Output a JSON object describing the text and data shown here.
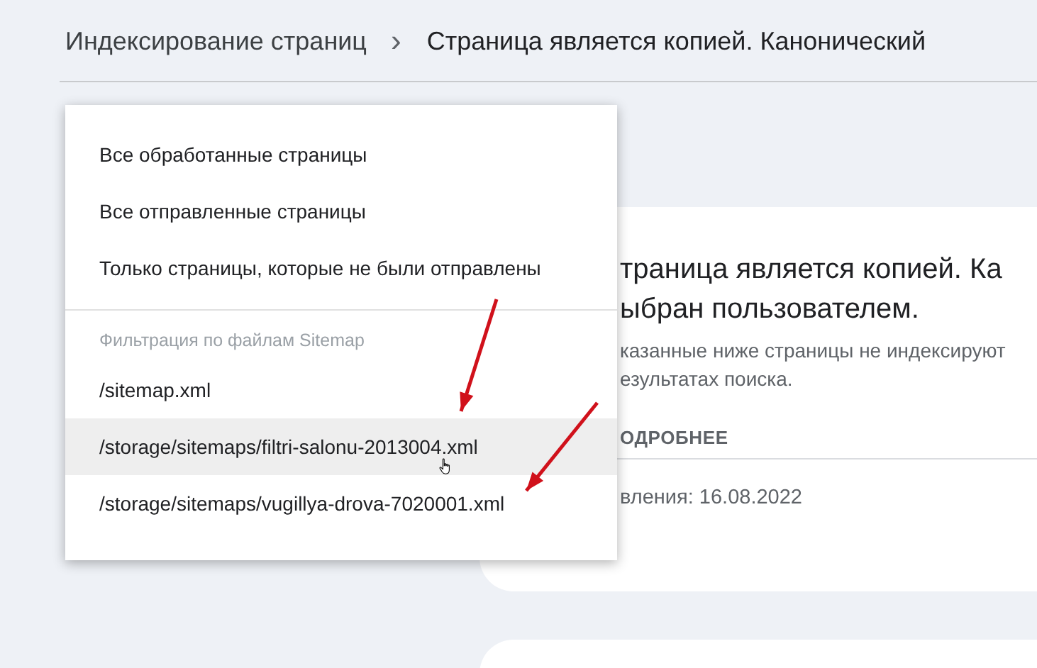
{
  "breadcrumb": {
    "parent": "Индексирование страниц",
    "separator": "›",
    "current": "Страница является копией. Канонический"
  },
  "menu": {
    "items": [
      {
        "label": "Все обработанные страницы",
        "hovered": false
      },
      {
        "label": "Все отправленные страницы",
        "hovered": false
      },
      {
        "label": "Только страницы, которые не были отправлены",
        "hovered": false
      }
    ],
    "section_header": "Фильтрация по файлам Sitemap",
    "sitemaps": [
      {
        "label": "/sitemap.xml",
        "hovered": false
      },
      {
        "label": "/storage/sitemaps/filtri-salonu-2013004.xml",
        "hovered": true
      },
      {
        "label": "/storage/sitemaps/vugillya-drova-7020001.xml",
        "hovered": false
      }
    ]
  },
  "card": {
    "title_lines": [
      "траница является копией. Ка",
      "ыбран пользователем."
    ],
    "description_lines": [
      "казанные ниже страницы не индексируют",
      "езультатах поиска."
    ],
    "link": "ОДРОБНЕЕ",
    "footer": "вления: 16.08.2022"
  }
}
